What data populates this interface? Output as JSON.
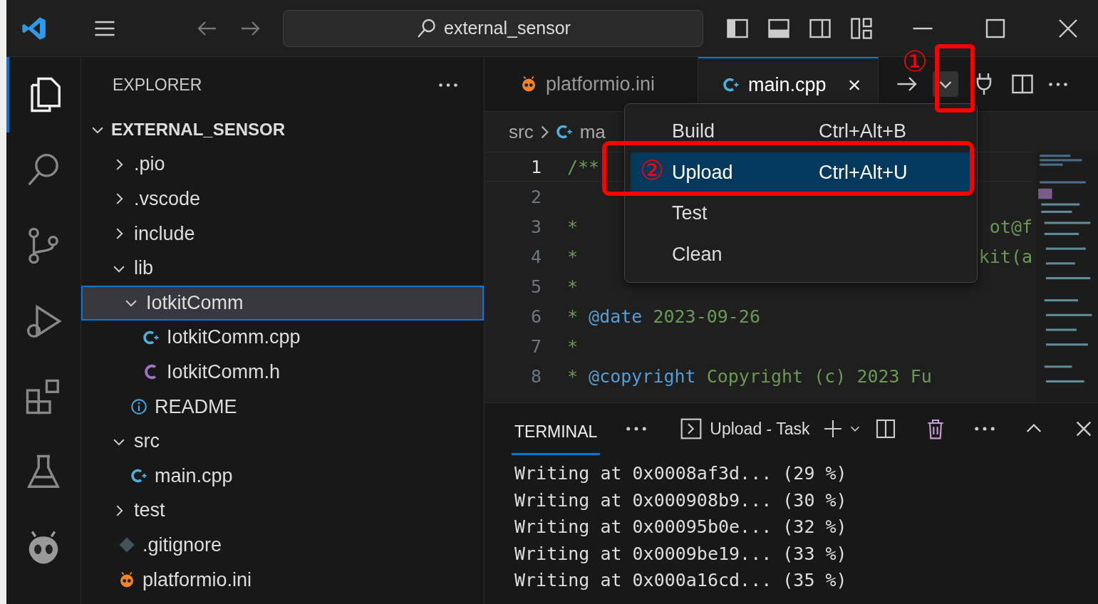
{
  "title_bar": {
    "search": "external_sensor"
  },
  "explorer": {
    "title": "EXPLORER",
    "root": "EXTERNAL_SENSOR",
    "root_expanded": true,
    "items": [
      {
        "label": ".pio",
        "kind": "folder",
        "expanded": false,
        "selected": false
      },
      {
        "label": ".vscode",
        "kind": "folder",
        "expanded": false,
        "selected": false
      },
      {
        "label": "include",
        "kind": "folder",
        "expanded": false,
        "selected": false
      },
      {
        "label": "lib",
        "kind": "folder",
        "expanded": true,
        "selected": false,
        "children": [
          {
            "label": "IotkitComm",
            "kind": "folder",
            "expanded": true,
            "selected": true,
            "children": [
              {
                "label": "IotkitComm.cpp",
                "kind": "cpp",
                "selected": false
              },
              {
                "label": "IotkitComm.h",
                "kind": "h",
                "selected": false
              }
            ]
          },
          {
            "label": "README",
            "kind": "info",
            "selected": false
          }
        ]
      },
      {
        "label": "src",
        "kind": "folder",
        "expanded": true,
        "selected": false,
        "children": [
          {
            "label": "main.cpp",
            "kind": "cpp",
            "selected": false
          }
        ]
      },
      {
        "label": "test",
        "kind": "folder",
        "expanded": false,
        "selected": false
      },
      {
        "label": ".gitignore",
        "kind": "git",
        "selected": false
      },
      {
        "label": "platformio.ini",
        "kind": "pio",
        "selected": false
      }
    ]
  },
  "tabs": [
    {
      "label": "platformio.ini",
      "kind": "pio",
      "selected": false
    },
    {
      "label": "main.cpp",
      "kind": "cpp",
      "selected": true,
      "close": "×"
    }
  ],
  "breadcrumb": [
    "src",
    "ma"
  ],
  "run_menu": [
    {
      "label": "Build",
      "shortcut": "Ctrl+Alt+B",
      "selected": false
    },
    {
      "label": "Upload",
      "shortcut": "Ctrl+Alt+U",
      "selected": true
    },
    {
      "label": "Test",
      "selected": false
    },
    {
      "label": "Clean",
      "selected": false
    }
  ],
  "code": [
    {
      "number": "1",
      "text": "/**",
      "current": true
    },
    {
      "number": "2",
      "current": false
    },
    {
      "number": "3",
      "text": "*",
      "tail": "ot@f",
      "current": false
    },
    {
      "number": "4",
      "text": "*",
      "tail": "kit(a",
      "current": false
    },
    {
      "number": "5",
      "text": "*",
      "current": false
    },
    {
      "number": "6",
      "text": "* **@date** 2023-09-26",
      "current": false
    },
    {
      "number": "7",
      "text": "*",
      "current": false
    },
    {
      "number": "8",
      "text": "* **@copyright** Copyright (c) 2023 Fu",
      "current": false
    }
  ],
  "terminal": {
    "tab": "TERMINAL",
    "task": "Upload - Task",
    "lines": [
      "Writing at 0x0008af3d... (29 %)",
      "Writing at 0x000908b9... (30 %)",
      "Writing at 0x00095b0e... (32 %)",
      "Writing at 0x0009be19... (33 %)",
      "Writing at 0x000a16cd... (35 %)"
    ]
  },
  "annotations": [
    "①",
    "②"
  ]
}
